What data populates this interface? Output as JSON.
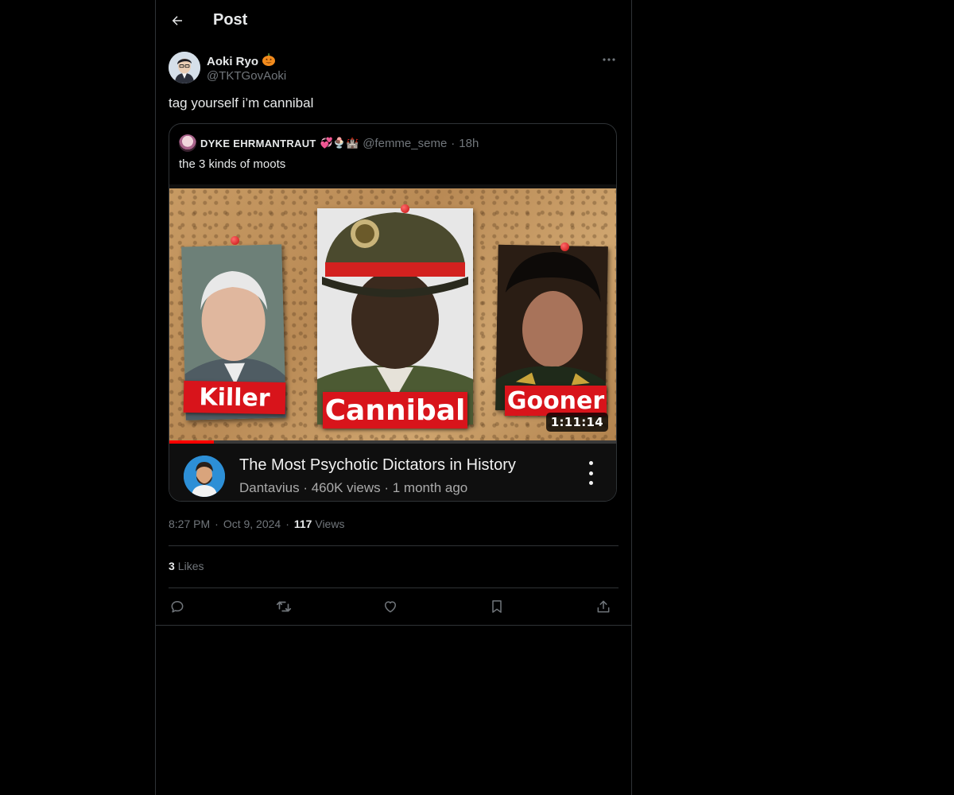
{
  "header": {
    "title": "Post"
  },
  "author": {
    "name": "Aoki Ryo",
    "name_emoji": "🎃",
    "handle": "@TKTGovAoki"
  },
  "tweet": {
    "text": "tag yourself i’m cannibal"
  },
  "quote": {
    "name": "DYKE EHRMANTRAUT",
    "emojis": "💞🍨🏰",
    "handle": "@femme_seme",
    "separator": "·",
    "time": "18h",
    "text": "the 3 kinds of moots",
    "video": {
      "labels": [
        "Killer",
        "Cannibal",
        "Gooner"
      ],
      "duration": "1:11:14",
      "progress_fraction": 0.1,
      "title": "The Most Psychotic Dictators in History",
      "meta": "Dantavius · 460K views · 1 month ago"
    }
  },
  "meta": {
    "time": "8:27 PM",
    "sep": "·",
    "date": "Oct 9, 2024",
    "views_count": "117",
    "views_label": "Views"
  },
  "likes": {
    "count": "3",
    "label": "Likes"
  },
  "actions": [
    "reply-icon",
    "repost-icon",
    "like-icon",
    "bookmark-icon",
    "share-icon"
  ],
  "colors": {
    "background": "#000000",
    "text": "#e7e9ea",
    "secondary": "#71767b",
    "border": "#2f3336",
    "label_red": "#d8141b"
  }
}
